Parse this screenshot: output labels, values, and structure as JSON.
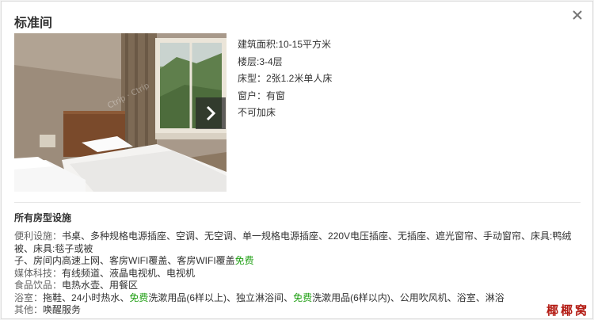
{
  "dialog": {
    "title": "标准间",
    "close_icon": "close-icon",
    "next_icon": "chevron-right-icon"
  },
  "room_info": {
    "area": "建筑面积:10-15平方米",
    "floor": "楼层:3-4层",
    "bed": "床型：2张1.2米单人床",
    "window": "窗户：有窗",
    "extra_bed": "不可加床"
  },
  "facilities": {
    "section_title": "所有房型设施",
    "convenience": {
      "label": "便利设施：",
      "text_line1": "书桌、多种规格电源插座、空调、无空调、单一规格电源插座、220V电压插座、无插座、遮光窗帘、手动窗帘、床具:鸭绒被、床具:毯子或被",
      "text_line2a": "子、房间内高速上网、客房WIFI覆盖、客房WIFI覆盖",
      "free": "免费"
    },
    "media": {
      "label": "媒体科技：",
      "text": "有线频道、液晶电视机、电视机"
    },
    "food": {
      "label": "食品饮品：",
      "text": "电热水壶、用餐区"
    },
    "bath": {
      "label": "浴室：",
      "text_a": "拖鞋、24小时热水、",
      "free1": "免费",
      "text_b": "洗漱用品(6样以上)、独立淋浴间、",
      "free2": "免费",
      "text_c": "洗漱用品(6样以内)、公用吹风机、浴室、淋浴"
    },
    "other": {
      "label": "其他：",
      "text": "唤醒服务"
    }
  },
  "watermark": "椰椰窝",
  "colors": {
    "free_green": "#22a016",
    "watermark_red": "#b31a12"
  }
}
